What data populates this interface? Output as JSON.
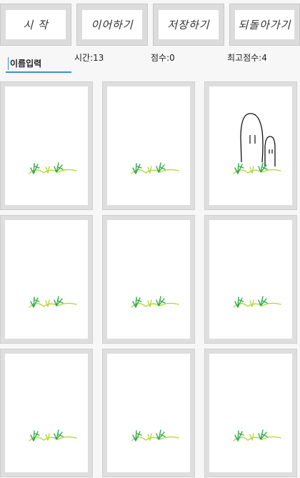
{
  "toolbar": {
    "start_label": "시 작",
    "load_label": "이어하기",
    "save_label": "저장하기",
    "back_label": "되돌아가기"
  },
  "status": {
    "name_placeholder": "이름입력",
    "time_text": "시간:13",
    "score_text": "점수:0",
    "high_score_text": "최고점수:4"
  },
  "board": {
    "cards": [
      {
        "content": "grass"
      },
      {
        "content": "grass"
      },
      {
        "content": "mole-pair"
      },
      {
        "content": "grass"
      },
      {
        "content": "grass"
      },
      {
        "content": "grass"
      },
      {
        "content": "grass"
      },
      {
        "content": "grass"
      },
      {
        "content": "grass"
      }
    ]
  },
  "colors": {
    "grass_dark": "#2faa48",
    "grass_light": "#b5d93a",
    "input_accent": "#3b8fd9"
  }
}
